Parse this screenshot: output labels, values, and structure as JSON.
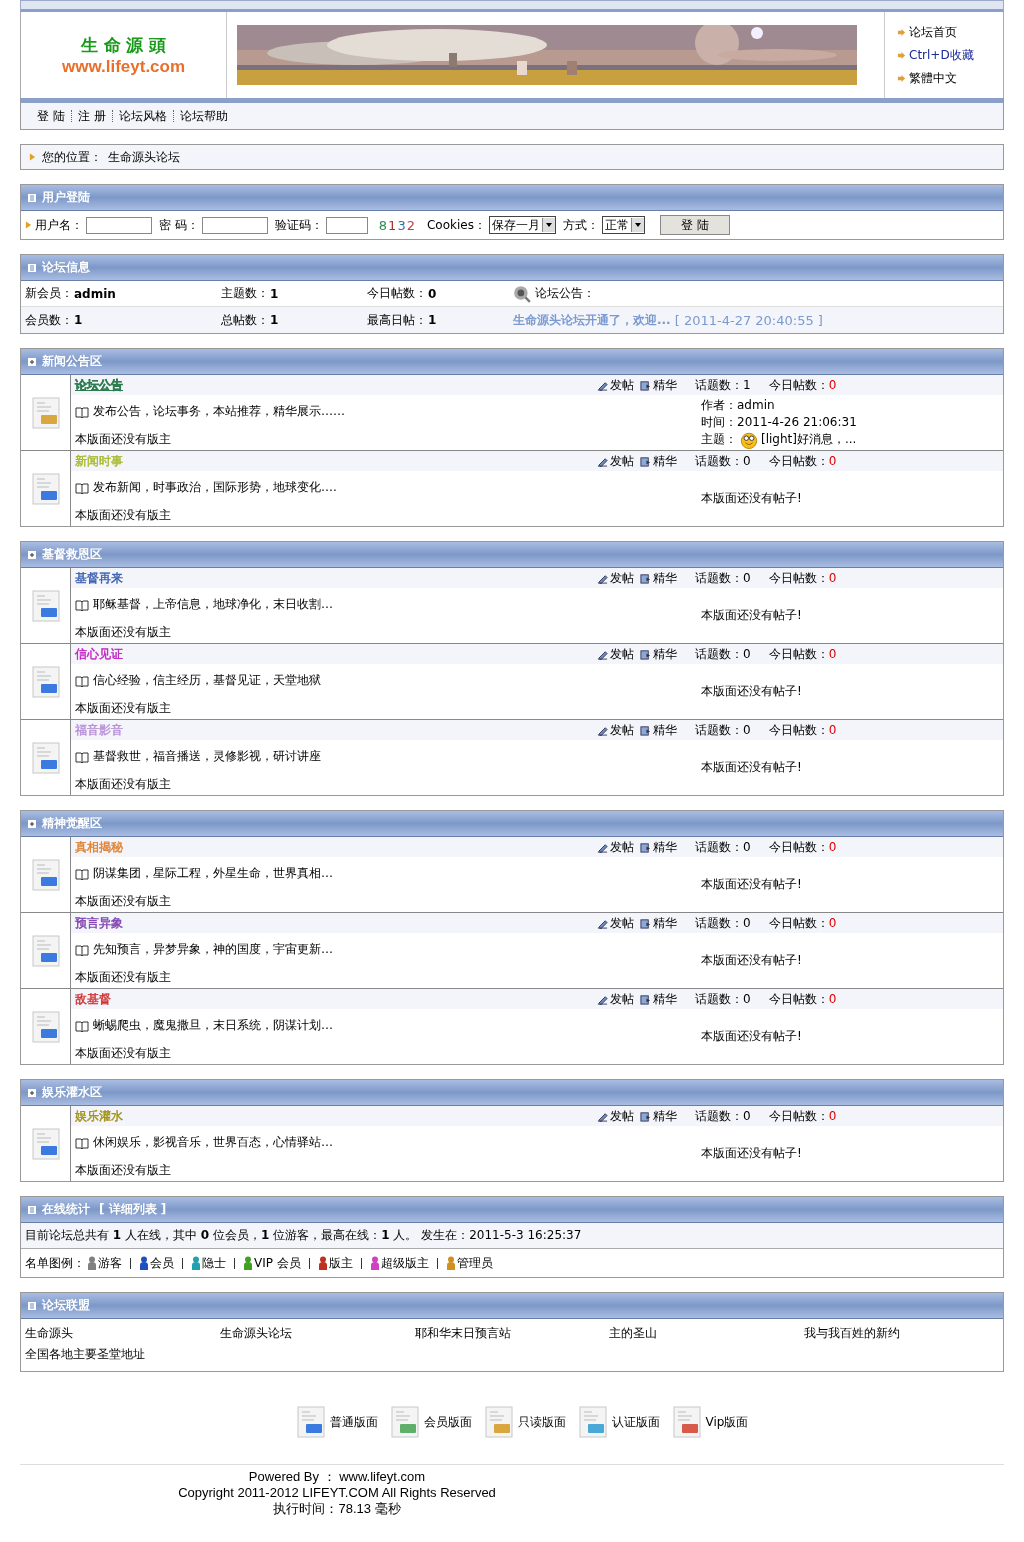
{
  "header": {
    "logo_title": "生 命 源 頭",
    "logo_url": "www.lifeyt.com",
    "links": [
      "论坛首页",
      "Ctrl+D收藏",
      "繁體中文"
    ]
  },
  "nav": [
    "登 陆",
    "注 册",
    "论坛风格",
    "论坛帮助"
  ],
  "breadcrumb": {
    "label": "您的位置：",
    "value": "生命源头论坛"
  },
  "login": {
    "title": "用户登陆",
    "username_label": "用户名：",
    "password_label": "密 码：",
    "captcha_label": "验证码：",
    "captcha": [
      {
        "char": "8",
        "color": "#2e8b57"
      },
      {
        "char": "1",
        "color": "#b03030"
      },
      {
        "char": "3",
        "color": "#3070b0"
      },
      {
        "char": "2",
        "color": "#c04040"
      }
    ],
    "cookies_label": "Cookies：",
    "cookies_value": "保存一月",
    "mode_label": "方式：",
    "mode_value": "正常",
    "button": "登 陆"
  },
  "forum_info": {
    "title": "论坛信息",
    "stats": [
      {
        "label": "新会员：",
        "value": "admin"
      },
      {
        "label": "主题数：",
        "value": "1"
      },
      {
        "label": "今日帖数：",
        "value": "0"
      },
      {
        "label": "会员数：",
        "value": "1"
      },
      {
        "label": "总帖数：",
        "value": "1"
      },
      {
        "label": "最高日帖：",
        "value": "1"
      }
    ],
    "notice_label": "论坛公告：",
    "notice": "生命源头论坛开通了，欢迎...",
    "notice_time": "[ 2011-4-27 20:40:55 ]"
  },
  "sections": [
    {
      "title": "新闻公告区",
      "forums": [
        {
          "name": "论坛公告",
          "color": "#2e7d4f",
          "kind": "readonly",
          "description": "发布公告，论坛事务，本站推荐，精华展示……",
          "moderator": "本版面还没有版主",
          "post_label": "发帖",
          "best_label": "精华",
          "topics_label": "话题数：",
          "topics": "1",
          "today_label": "今日帖数：",
          "today": "0",
          "last_post": {
            "author_label": "作者：",
            "author": "admin",
            "time_label": "时间：",
            "time": "2011-4-26 21:06:31",
            "subject_label": "主题：",
            "subject": "[light]好消息，..."
          }
        },
        {
          "name": "新闻时事",
          "color": "#a8b82a",
          "kind": "normal",
          "description": "发布新闻，时事政治，国际形势，地球变化….",
          "moderator": "本版面还没有版主",
          "post_label": "发帖",
          "best_label": "精华",
          "topics_label": "话题数：",
          "topics": "0",
          "today_label": "今日帖数：",
          "today": "0",
          "no_posts": "本版面还没有帖子!"
        }
      ]
    },
    {
      "title": "基督救恩区",
      "forums": [
        {
          "name": "基督再来",
          "color": "#3a5fb0",
          "kind": "normal",
          "description": "耶稣基督，上帝信息，地球净化，末日收割…",
          "moderator": "本版面还没有版主",
          "post_label": "发帖",
          "best_label": "精华",
          "topics_label": "话题数：",
          "topics": "0",
          "today_label": "今日帖数：",
          "today": "0",
          "no_posts": "本版面还没有帖子!"
        },
        {
          "name": "信心见证",
          "color": "#c020c0",
          "kind": "normal",
          "description": "信心经验，信主经历，基督见证，天堂地狱",
          "moderator": "本版面还没有版主",
          "post_label": "发帖",
          "best_label": "精华",
          "topics_label": "话题数：",
          "topics": "0",
          "today_label": "今日帖数：",
          "today": "0",
          "no_posts": "本版面还没有帖子!"
        },
        {
          "name": "福音影音",
          "color": "#b890d8",
          "kind": "normal",
          "description": "基督救世，福音播送，灵修影视，研讨讲座",
          "moderator": "本版面还没有版主",
          "post_label": "发帖",
          "best_label": "精华",
          "topics_label": "话题数：",
          "topics": "0",
          "today_label": "今日帖数：",
          "today": "0",
          "no_posts": "本版面还没有帖子!"
        }
      ]
    },
    {
      "title": "精神觉醒区",
      "forums": [
        {
          "name": "真相揭秘",
          "color": "#e08030",
          "kind": "normal",
          "description": "阴谋集团，星际工程，外星生命，世界真相…",
          "moderator": "本版面还没有版主",
          "post_label": "发帖",
          "best_label": "精华",
          "topics_label": "话题数：",
          "topics": "0",
          "today_label": "今日帖数：",
          "today": "0",
          "no_posts": "本版面还没有帖子!"
        },
        {
          "name": "预言异象",
          "color": "#8040b0",
          "kind": "normal",
          "description": "先知预言，异梦异象，神的国度，宇宙更新…",
          "moderator": "本版面还没有版主",
          "post_label": "发帖",
          "best_label": "精华",
          "topics_label": "话题数：",
          "topics": "0",
          "today_label": "今日帖数：",
          "today": "0",
          "no_posts": "本版面还没有帖子!"
        },
        {
          "name": "敌基督",
          "color": "#d03030",
          "kind": "normal",
          "description": "蜥蜴爬虫，魔鬼撒旦，末日系统，阴谋计划…",
          "moderator": "本版面还没有版主",
          "post_label": "发帖",
          "best_label": "精华",
          "topics_label": "话题数：",
          "topics": "0",
          "today_label": "今日帖数：",
          "today": "0",
          "no_posts": "本版面还没有帖子!"
        }
      ]
    },
    {
      "title": "娱乐灌水区",
      "forums": [
        {
          "name": "娱乐灌水",
          "color": "#a09010",
          "kind": "normal",
          "description": "休闲娱乐，影视音乐，世界百态，心情驿站…",
          "moderator": "本版面还没有版主",
          "post_label": "发帖",
          "best_label": "精华",
          "topics_label": "话题数：",
          "topics": "0",
          "today_label": "今日帖数：",
          "today": "0",
          "no_posts": "本版面还没有帖子!"
        }
      ]
    }
  ],
  "online": {
    "title": "在线统计",
    "link": "[ 详细列表 ]",
    "summary": "目前论坛总共有 **1** 人在线，其中 **0** 位会员，**1** 位游客，最高在线：**1** 人。 发生在：2011-5-3 16:25:37",
    "legend_label": "名单图例：",
    "legend": [
      {
        "label": "游客",
        "color": "#808080"
      },
      {
        "label": "会员",
        "color": "#2050c0"
      },
      {
        "label": "隐士",
        "color": "#20a0b0"
      },
      {
        "label": "VIP 会员",
        "color": "#40a020"
      },
      {
        "label": "版主",
        "color": "#c03020"
      },
      {
        "label": "超级版主",
        "color": "#d040c0"
      },
      {
        "label": "管理员",
        "color": "#d09020"
      }
    ]
  },
  "alliance": {
    "title": "论坛联盟",
    "links": [
      "生命源头",
      "生命源头论坛",
      "耶和华末日预言站",
      "主的圣山",
      "我与我百姓的新约",
      "全国各地主要圣堂地址"
    ]
  },
  "board_legend": [
    {
      "label": "普通版面",
      "kind": "normal"
    },
    {
      "label": "会员版面",
      "kind": "member"
    },
    {
      "label": "只读版面",
      "kind": "readonly"
    },
    {
      "label": "认证版面",
      "kind": "verified"
    },
    {
      "label": "Vip版面",
      "kind": "vip"
    }
  ],
  "footer": [
    "Powered By ：  www.lifeyt.com",
    "Copyright 2011-2012 LIFEYT.COM All Rights Reserved",
    "执行时间：78.13 毫秒"
  ]
}
